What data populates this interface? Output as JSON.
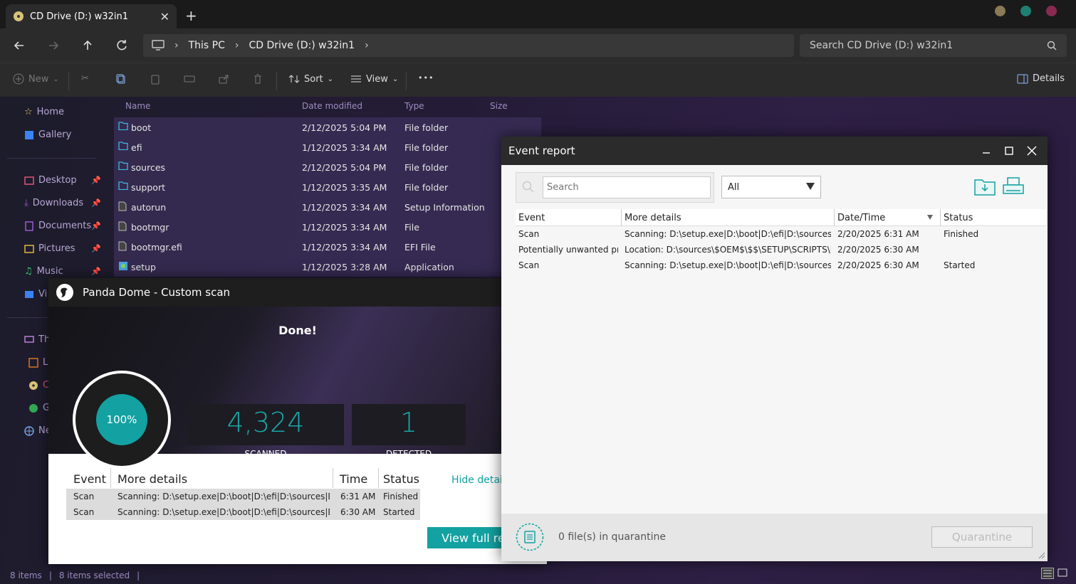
{
  "window": {
    "tab_title": "CD Drive (D:) w32in1",
    "close_glyph": "✕",
    "newtab_glyph": "+"
  },
  "address": {
    "segments": [
      "This PC",
      "CD Drive (D:) w32in1"
    ],
    "search_placeholder": "Search CD Drive (D:) w32in1"
  },
  "toolbar": {
    "new_label": "New",
    "sort_label": "Sort",
    "view_label": "View",
    "more_label": "•••",
    "details_label": "Details"
  },
  "sidebar": {
    "items": [
      {
        "label": "Home",
        "icon": "star-icon"
      },
      {
        "label": "Gallery",
        "icon": "gallery-icon"
      },
      {
        "label": "Desktop",
        "icon": "desktop-icon"
      },
      {
        "label": "Downloads",
        "icon": "download-icon"
      },
      {
        "label": "Documents",
        "icon": "document-icon"
      },
      {
        "label": "Pictures",
        "icon": "picture-icon"
      },
      {
        "label": "Music",
        "icon": "music-icon"
      },
      {
        "label": "Vi",
        "icon": "video-icon"
      },
      {
        "label": "Th",
        "icon": "pc-icon"
      },
      {
        "label": "L",
        "icon": "drive-icon"
      },
      {
        "label": "C",
        "icon": "cd-icon"
      },
      {
        "label": "G",
        "icon": "drive-icon"
      },
      {
        "label": "Ne",
        "icon": "network-icon"
      }
    ]
  },
  "filelist": {
    "columns": [
      "Name",
      "Date modified",
      "Type",
      "Size"
    ],
    "rows": [
      {
        "name": "boot",
        "date": "2/12/2025 5:04 PM",
        "type": "File folder",
        "icon": "folder-icon"
      },
      {
        "name": "efi",
        "date": "1/12/2025 3:34 AM",
        "type": "File folder",
        "icon": "folder-icon"
      },
      {
        "name": "sources",
        "date": "2/12/2025 5:04 PM",
        "type": "File folder",
        "icon": "folder-icon"
      },
      {
        "name": "support",
        "date": "1/12/2025 3:35 AM",
        "type": "File folder",
        "icon": "folder-icon"
      },
      {
        "name": "autorun",
        "date": "1/12/2025 3:34 AM",
        "type": "Setup Information",
        "icon": "file-icon"
      },
      {
        "name": "bootmgr",
        "date": "1/12/2025 3:34 AM",
        "type": "File",
        "icon": "file-icon"
      },
      {
        "name": "bootmgr.efi",
        "date": "1/12/2025 3:34 AM",
        "type": "EFI File",
        "icon": "file-icon"
      },
      {
        "name": "setup",
        "date": "1/12/2025 3:28 AM",
        "type": "Application",
        "icon": "setup-icon"
      }
    ]
  },
  "statusbar": {
    "items": "8 items",
    "selected": "8 items selected"
  },
  "panda": {
    "title": "Panda Dome - Custom scan",
    "done": "Done!",
    "progress": "100%",
    "scanned_value": "4,324",
    "scanned_label": "SCANNED",
    "detected_value": "1",
    "detected_label": "DETECTED",
    "columns": [
      "Event",
      "More details",
      "Time",
      "Status"
    ],
    "rows": [
      {
        "event": "Scan",
        "details": "Scanning: D:\\setup.exe|D:\\boot|D:\\efi|D:\\sources|D:\\s...",
        "time": "6:31 AM",
        "status": "Finished"
      },
      {
        "event": "Scan",
        "details": "Scanning: D:\\setup.exe|D:\\boot|D:\\efi|D:\\sources|D:\\s...",
        "time": "6:30 AM",
        "status": "Started"
      }
    ],
    "hide_details": "Hide detail",
    "view_full": "View full rep"
  },
  "event_report": {
    "title": "Event report",
    "search_placeholder": "Search",
    "filter_value": "All",
    "columns": [
      "Event",
      "More details",
      "Date/Time",
      "Status"
    ],
    "rows": [
      {
        "event": "Scan",
        "details": "Scanning: D:\\setup.exe|D:\\boot|D:\\efi|D:\\sources|D:\\...",
        "datetime": "2/20/2025 6:31 AM",
        "status": "Finished"
      },
      {
        "event": "Potentially unwanted pr...",
        "details": "Location: D:\\sources\\$OEM$\\$$\\SETUP\\SCRIPTS\\K...",
        "datetime": "2/20/2025 6:30 AM",
        "status": ""
      },
      {
        "event": "Scan",
        "details": "Scanning: D:\\setup.exe|D:\\boot|D:\\efi|D:\\sources|D:\\...",
        "datetime": "2/20/2025 6:30 AM",
        "status": "Started"
      }
    ],
    "quarantine_text": "0 file(s) in quarantine",
    "quarantine_button": "Quarantine"
  },
  "colors": {
    "accent_teal": "#13a1a1",
    "sidebar_text": "#b9a7d6"
  }
}
